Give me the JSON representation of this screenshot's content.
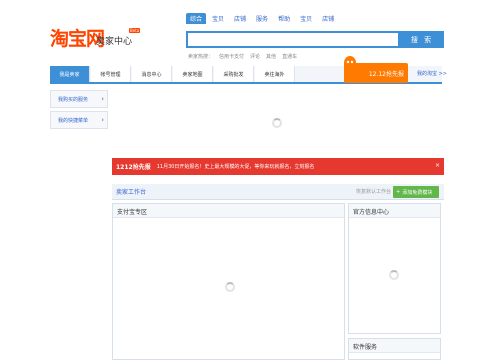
{
  "brand": {
    "logo": "淘宝网",
    "subtitle": "卖家中心",
    "badge": "Beta"
  },
  "search": {
    "tabs": [
      "综合",
      "宝贝",
      "店铺",
      "服务",
      "帮助",
      "宝贝",
      "店铺"
    ],
    "button_label": "搜 索",
    "hotwords_label": "卖家热搜：",
    "hotwords": [
      "信用卡支付",
      "评论",
      "其他",
      "直通车"
    ]
  },
  "nav": {
    "items": [
      "我是卖家",
      "帐号管理",
      "消息中心",
      "卖家地图",
      "采购批发",
      "卖往海外"
    ],
    "promo": "12.12抢先报",
    "my_taobao": "我的淘宝 >>"
  },
  "sidebar": {
    "items": [
      "我购买的服务",
      "我的快捷菜单"
    ]
  },
  "banner": {
    "title": "1212抢先报",
    "text": "11月30日开始报名！史上最大规模的大促，等你来玩就报名，立刻报名",
    "close": "×"
  },
  "workspace": {
    "title": "卖家工作台",
    "set_default": "恢复默认工作台",
    "add_button": "添加免费模块",
    "panels": {
      "alipay": "支付宝专区",
      "official": "官方信息中心",
      "software": "软件服务"
    }
  },
  "colors": {
    "accent": "#3d8fd6",
    "brand": "#ff4400",
    "banner": "#e5382e",
    "add_button": "#62b64a"
  }
}
